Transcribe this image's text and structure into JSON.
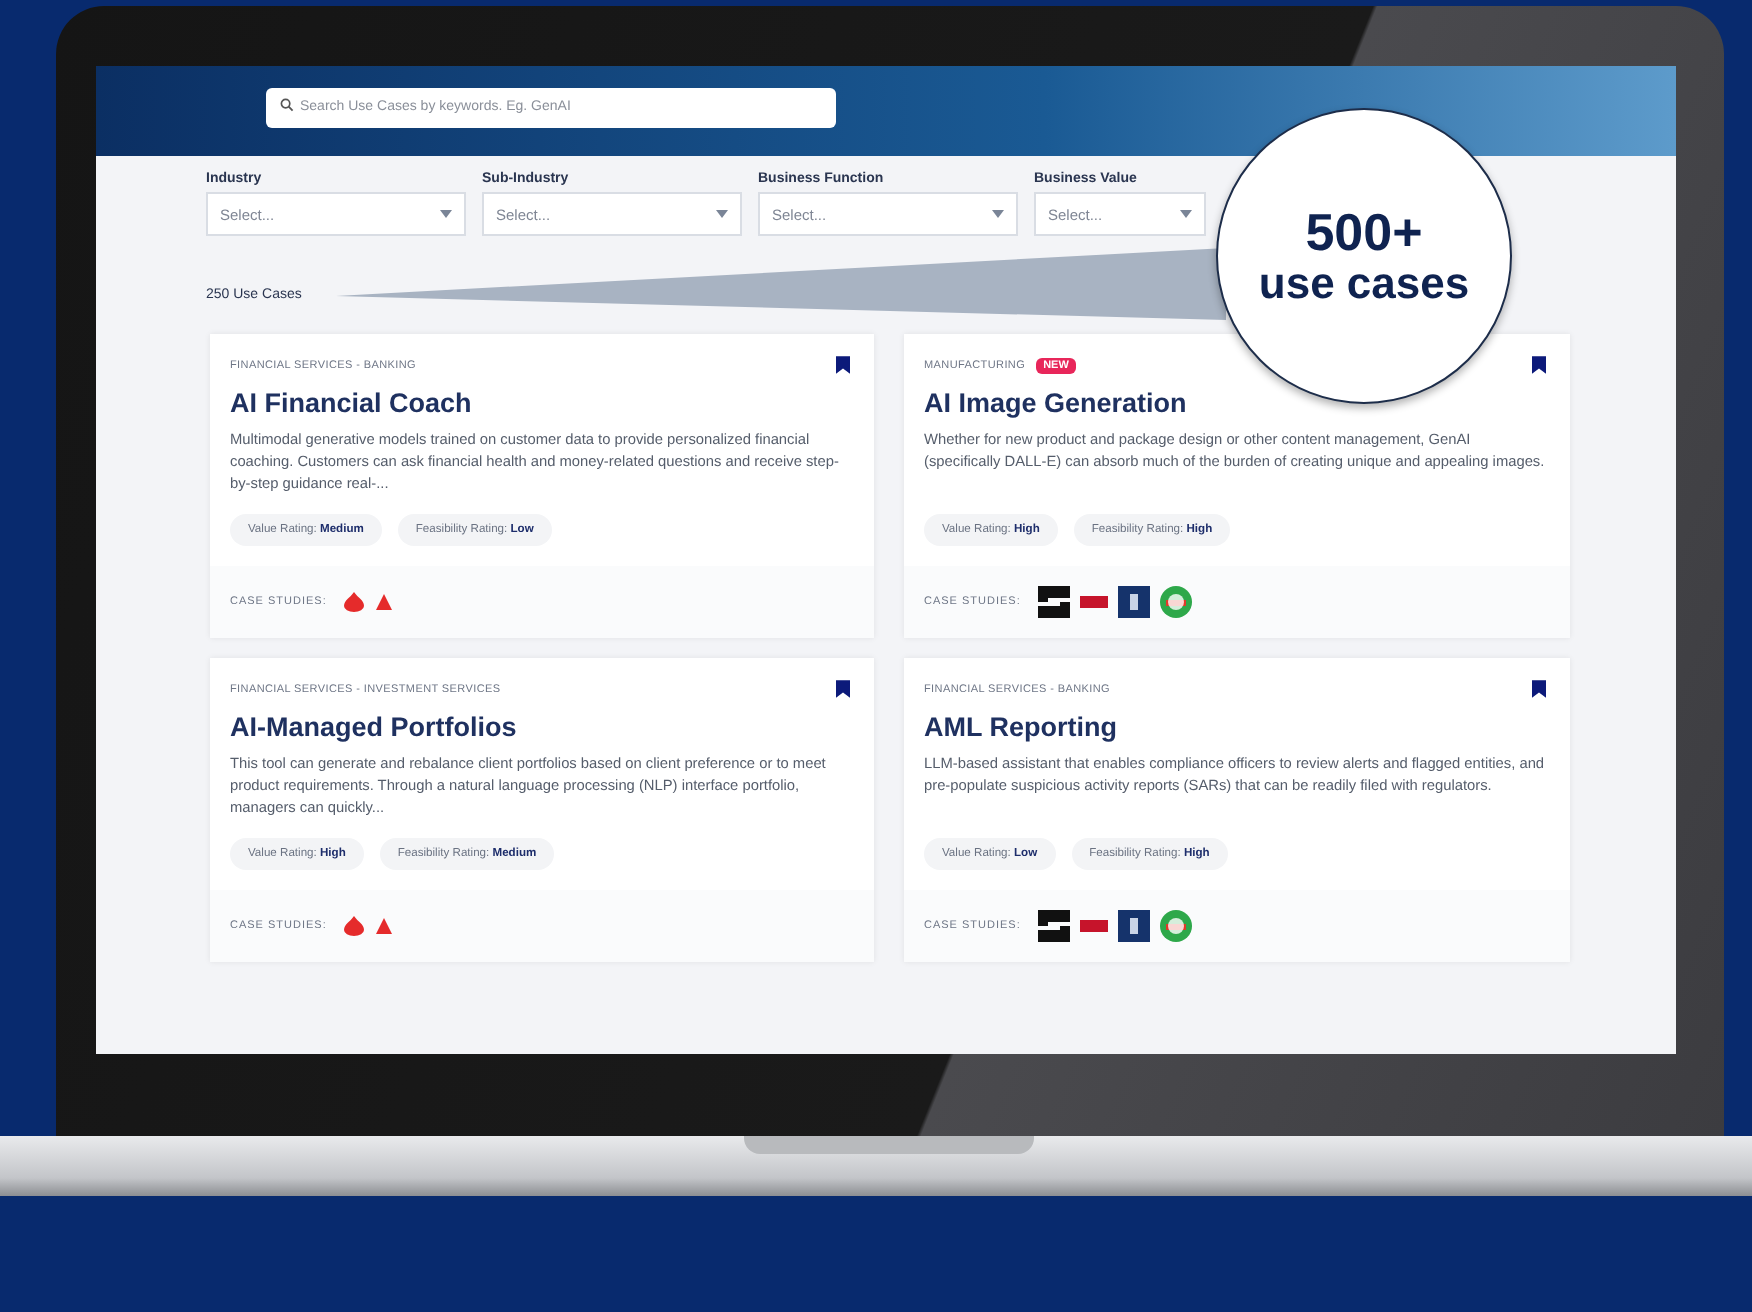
{
  "search": {
    "placeholder": "Search Use Cases by keywords. Eg. GenAI"
  },
  "filters": [
    {
      "label": "Industry",
      "placeholder": "Select..."
    },
    {
      "label": "Sub-Industry",
      "placeholder": "Select..."
    },
    {
      "label": "Business Function",
      "placeholder": "Select..."
    },
    {
      "label": "Business Value",
      "placeholder": "Select..."
    }
  ],
  "result_count": "250 Use Cases",
  "callout": {
    "number": "500+",
    "text": "use cases"
  },
  "cards": [
    {
      "category": "FINANCIAL SERVICES - BANKING",
      "title": "AI Financial Coach",
      "description": "Multimodal generative models trained on customer data to provide personalized financial coaching. Customers can ask financial health and money-related questions and receive step-by-step guidance real-...",
      "ratings": [
        "Value Rating: **Medium**",
        "Feasibility Rating: **Low**"
      ],
      "case_studies_label": "CASE STUDIES:",
      "logos": [
        {
          "kind": "flame"
        },
        {
          "kind": "arch"
        }
      ]
    },
    {
      "category": "MANUFACTURING",
      "badge": "NEW",
      "title": "AI Image Generation",
      "description": "Whether for new product and package design or other content management, GenAI (specifically DALL-E) can absorb much of the burden of creating unique and appealing images.",
      "ratings": [
        "Value Rating: **High**",
        "Feasibility Rating: **High**"
      ],
      "case_studies_label": "CASE STUDIES:",
      "logos": [
        {
          "kind": "bars"
        },
        {
          "kind": "stripe"
        },
        {
          "kind": "shield"
        },
        {
          "kind": "globe"
        }
      ]
    },
    {
      "category": "FINANCIAL SERVICES - INVESTMENT SERVICES",
      "title": "AI-Managed Portfolios",
      "description": "This tool can generate and rebalance client portfolios based on client preference or to meet product requirements. Through a natural language processing (NLP) interface portfolio, managers can quickly...",
      "ratings": [
        "Value Rating: **High**",
        "Feasibility Rating: **Medium**"
      ],
      "case_studies_label": "CASE STUDIES:",
      "logos": [
        {
          "kind": "flame"
        },
        {
          "kind": "arch"
        }
      ]
    },
    {
      "category": "FINANCIAL SERVICES - BANKING",
      "title": "AML Reporting",
      "description": "LLM-based assistant that enables compliance officers to review alerts and flagged entities, and pre-populate suspicious activity reports (SARs) that can be readily filed with regulators.",
      "ratings": [
        "Value Rating: **Low**",
        "Feasibility Rating: **High**"
      ],
      "case_studies_label": "CASE STUDIES:",
      "logos": [
        {
          "kind": "bars"
        },
        {
          "kind": "stripe"
        },
        {
          "kind": "shield"
        },
        {
          "kind": "globe"
        }
      ]
    }
  ]
}
